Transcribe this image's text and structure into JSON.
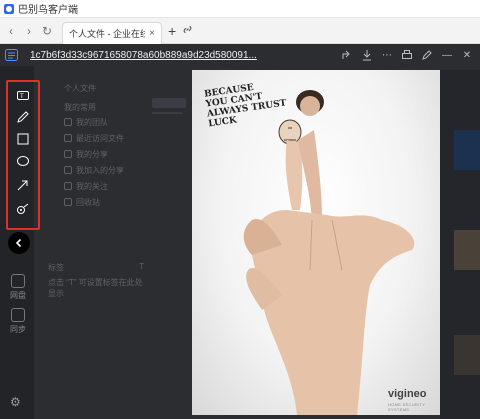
{
  "titlebar": {
    "app_title": "巴别鸟客户端"
  },
  "tabbar": {
    "tab_label": "个人文件 - 企业在线...",
    "tab_close": "×",
    "new_tab": "+",
    "link_icon": "link-icon"
  },
  "viewer": {
    "filename": "1c7b6f3d33c9671658078a60b889a9d23d580091..."
  },
  "annotation_tools": [
    "text-box-tool",
    "pen-tool",
    "rectangle-tool",
    "ellipse-tool",
    "arrow-tool",
    "mosaic-tool"
  ],
  "background_sidebar": {
    "top_item": "个人文件",
    "section": "我的常用",
    "items": [
      "我的团队",
      "最近访问文件",
      "我的分享",
      "我加入的分享",
      "我的关注",
      "回收站"
    ],
    "tags_label": "标签",
    "tags_hint": "点击 “T” 可设置标签在此处显示"
  },
  "rail": {
    "item1_label": "网盘",
    "item2_label": "同步"
  },
  "image": {
    "ad_text": "BECAUSE\nYOU CAN'T\nALWAYS TRUST\nLUCK",
    "brand": "vigineo",
    "brand_sub": "HOME SECURITY SYSTEMS"
  },
  "colors": {
    "highlight_border": "#e0302a",
    "background_dark": "#2b2d31"
  }
}
